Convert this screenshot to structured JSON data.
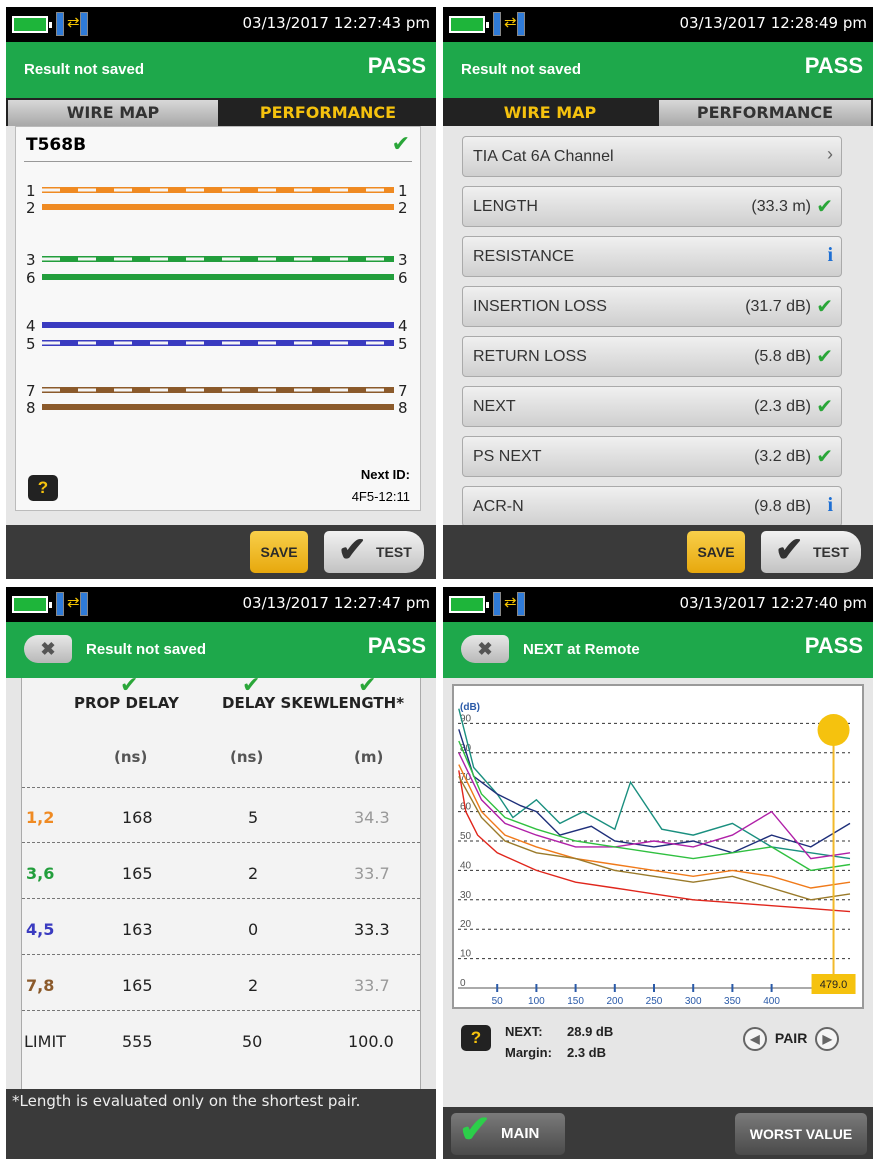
{
  "status_icons": [
    "battery-icon",
    "remote-unit-icon",
    "link-arrows-icon",
    "main-unit-icon"
  ],
  "colors": {
    "header_green": "#1ea84b",
    "orange": "#ef8a22",
    "green_pair": "#229e3c",
    "blue": "#3a3bc0",
    "brown": "#8b5a2b",
    "save_yellow": "#f2b92a",
    "limit_red": "#e0261c"
  },
  "panel1": {
    "timestamp": "03/13/2017 12:27:43 pm",
    "header_label": "Result not saved",
    "verdict": "PASS",
    "tabs": {
      "wire_map": "WIRE MAP",
      "performance": "PERFORMANCE"
    },
    "standard": "T568B",
    "pins": {
      "p1": "1",
      "p2": "2",
      "p3": "3",
      "p6": "6",
      "p4": "4",
      "p5": "5",
      "p7": "7",
      "p8": "8"
    },
    "help": "?",
    "next_id_label": "Next ID:",
    "next_id": "4F5-12:11",
    "save": "SAVE",
    "test": "TEST"
  },
  "panel2": {
    "timestamp": "03/13/2017 12:28:49 pm",
    "header_label": "Result not saved",
    "verdict": "PASS",
    "tabs": {
      "wire_map": "WIRE MAP",
      "performance": "PERFORMANCE"
    },
    "rows": [
      {
        "name": "TIA Cat 6A Channel",
        "value": "",
        "icon": "chevron-right-icon"
      },
      {
        "name": "LENGTH",
        "value": "(33.3 m)",
        "icon": "check-icon"
      },
      {
        "name": "RESISTANCE",
        "value": "",
        "icon": "info-icon"
      },
      {
        "name": "INSERTION LOSS",
        "value": "(31.7 dB)",
        "icon": "check-icon"
      },
      {
        "name": "RETURN LOSS",
        "value": "(5.8 dB)",
        "icon": "check-icon"
      },
      {
        "name": "NEXT",
        "value": "(2.3 dB)",
        "icon": "check-icon"
      },
      {
        "name": "PS NEXT",
        "value": "(3.2 dB)",
        "icon": "check-icon"
      },
      {
        "name": "ACR-N",
        "value": "(9.8 dB)",
        "icon": "info-icon"
      }
    ],
    "save": "SAVE",
    "test": "TEST"
  },
  "panel3": {
    "timestamp": "03/13/2017 12:27:47 pm",
    "header_label": "Result not saved",
    "verdict": "PASS",
    "columns": [
      "PROP DELAY",
      "DELAY SKEW",
      "LENGTH*"
    ],
    "units": [
      "(ns)",
      "(ns)",
      "(m)"
    ],
    "rows": [
      {
        "pair": "1,2",
        "prop_delay": "168",
        "delay_skew": "5",
        "length": "34.3"
      },
      {
        "pair": "3,6",
        "prop_delay": "165",
        "delay_skew": "2",
        "length": "33.7"
      },
      {
        "pair": "4,5",
        "prop_delay": "163",
        "delay_skew": "0",
        "length": "33.3"
      },
      {
        "pair": "7,8",
        "prop_delay": "165",
        "delay_skew": "2",
        "length": "33.7"
      }
    ],
    "limit": {
      "pair": "LIMIT",
      "prop_delay": "555",
      "delay_skew": "50",
      "length": "100.0"
    },
    "footnote": "*Length is evaluated only on the shortest pair."
  },
  "panel4": {
    "timestamp": "03/13/2017 12:27:40 pm",
    "header_label": "NEXT at Remote",
    "verdict": "PASS",
    "cursor_value": "479.0",
    "next_label": "NEXT:",
    "next_value": "28.9 dB",
    "margin_label": "Margin:",
    "margin_value": "2.3 dB",
    "pair_label": "PAIR",
    "help": "?",
    "main": "MAIN",
    "worst_value": "WORST VALUE"
  },
  "chart_data": {
    "type": "line",
    "title": "",
    "xlabel": "",
    "ylabel": "(dB)",
    "xlim": [
      0,
      500
    ],
    "ylim": [
      0,
      100
    ],
    "x_ticks": [
      50,
      100,
      150,
      200,
      250,
      300,
      350,
      400
    ],
    "y_ticks": [
      0,
      10,
      20,
      30,
      40,
      50,
      60,
      70,
      80,
      90
    ],
    "grid": true,
    "cursor_x": 479.0,
    "series": [
      {
        "color": "#e0261c",
        "x": [
          1,
          10,
          25,
          50,
          100,
          150,
          200,
          250,
          300,
          350,
          400,
          450,
          500
        ],
        "y": [
          74,
          60,
          52,
          46,
          40,
          36,
          34,
          32,
          30,
          29,
          28,
          27,
          26
        ]
      },
      {
        "color": "#1a8f7f",
        "x": [
          1,
          20,
          50,
          70,
          100,
          130,
          160,
          200,
          220,
          260,
          300,
          350,
          400,
          450,
          500
        ],
        "y": [
          95,
          75,
          66,
          58,
          64,
          56,
          60,
          54,
          70,
          54,
          52,
          56,
          48,
          46,
          44
        ]
      },
      {
        "color": "#1e2f7a",
        "x": [
          1,
          20,
          50,
          80,
          100,
          130,
          170,
          200,
          250,
          300,
          350,
          400,
          450,
          500
        ],
        "y": [
          88,
          72,
          66,
          62,
          60,
          52,
          55,
          50,
          48,
          50,
          46,
          52,
          48,
          56
        ]
      },
      {
        "color": "#b020a8",
        "x": [
          1,
          30,
          60,
          100,
          150,
          200,
          250,
          300,
          350,
          400,
          450,
          500
        ],
        "y": [
          80,
          64,
          56,
          52,
          48,
          48,
          50,
          48,
          52,
          60,
          44,
          46
        ]
      },
      {
        "color": "#f07a1a",
        "x": [
          1,
          30,
          60,
          100,
          150,
          200,
          250,
          300,
          350,
          400,
          450,
          500
        ],
        "y": [
          76,
          60,
          52,
          48,
          44,
          42,
          40,
          38,
          40,
          38,
          34,
          36
        ]
      },
      {
        "color": "#9a7a2a",
        "x": [
          1,
          30,
          60,
          100,
          150,
          200,
          250,
          300,
          350,
          400,
          450,
          500
        ],
        "y": [
          72,
          58,
          50,
          46,
          44,
          40,
          38,
          36,
          38,
          34,
          30,
          32
        ]
      },
      {
        "color": "#30c040",
        "x": [
          1,
          30,
          60,
          100,
          150,
          200,
          250,
          300,
          350,
          400,
          450,
          500
        ],
        "y": [
          84,
          66,
          58,
          54,
          50,
          48,
          46,
          44,
          46,
          48,
          40,
          42
        ]
      }
    ]
  }
}
